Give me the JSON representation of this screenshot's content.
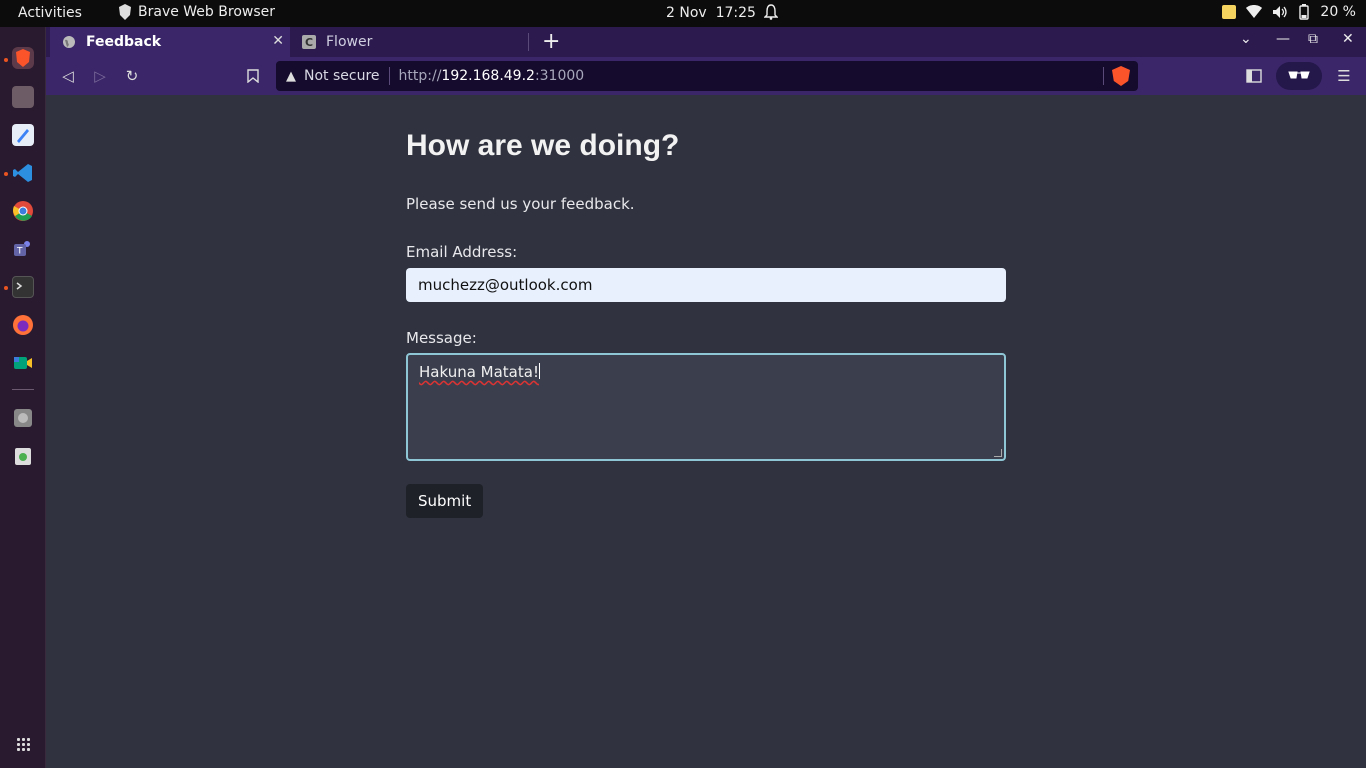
{
  "topbar": {
    "activities": "Activities",
    "app_name": "Brave Web Browser",
    "date": "2 Nov",
    "time": "17:25",
    "battery": "20 %",
    "icons": [
      "sticky-notes-icon",
      "wifi-icon",
      "volume-icon",
      "battery-icon",
      "bell-icon"
    ]
  },
  "dock": {
    "apps": [
      "brave",
      "files",
      "text-editor",
      "vscode",
      "chrome",
      "teams",
      "terminal",
      "firefox",
      "meet",
      "disk",
      "trash"
    ],
    "colors": {
      "brave": "#fb542b",
      "files": "#6d5b65",
      "text-editor": "#3b82f6",
      "vscode": "#2c8fe0",
      "chrome": "#e04a3a",
      "teams": "#6264a7",
      "terminal": "#333333",
      "firefox": "#ff7139",
      "meet": "#00a37a",
      "disk": "#888888",
      "trash": "#4caf50"
    }
  },
  "browser": {
    "tabs": [
      {
        "title": "Feedback",
        "active": true
      },
      {
        "title": "Flower",
        "active": false
      }
    ],
    "url": {
      "security": "Not secure",
      "scheme": "http://",
      "host": "192.168.49.2",
      "port": ":31000"
    }
  },
  "page": {
    "heading": "How are we doing?",
    "intro": "Please send us your feedback.",
    "email_label": "Email Address:",
    "email_value": "muchezz@outlook.com",
    "message_label": "Message:",
    "message_value": "Hakuna Matata!",
    "submit_label": "Submit"
  },
  "colors": {
    "page_bg": "#30333f",
    "toolbar": "#3a2668",
    "tabstrip": "#2c1a4f",
    "brave_orange": "#fb542b",
    "focus_border": "#8fc6d6"
  }
}
